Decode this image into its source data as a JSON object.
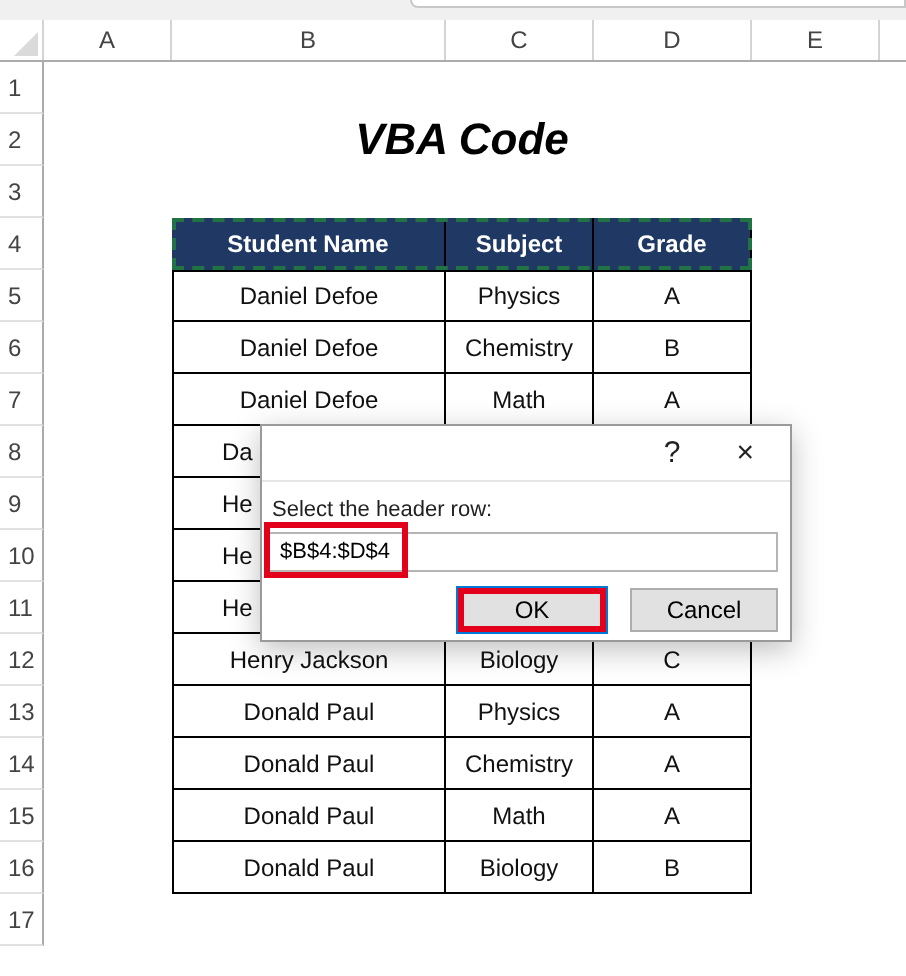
{
  "columns": [
    "A",
    "B",
    "C",
    "D",
    "E"
  ],
  "row_numbers": [
    "1",
    "2",
    "3",
    "4",
    "5",
    "6",
    "7",
    "8",
    "9",
    "10",
    "11",
    "12",
    "13",
    "14",
    "15",
    "16",
    "17"
  ],
  "title": "VBA Code",
  "table": {
    "columns": [
      "Student Name",
      "Subject",
      "Grade"
    ],
    "marquee": true,
    "rows": [
      {
        "cells": [
          "Daniel Defoe",
          "Physics",
          "A"
        ]
      },
      {
        "cells": [
          "Daniel Defoe",
          "Chemistry",
          "B"
        ]
      },
      {
        "cells": [
          "Daniel Defoe",
          "Math",
          "A"
        ]
      },
      {
        "cells": [
          "Da"
        ]
      },
      {
        "cells": [
          "He"
        ]
      },
      {
        "cells": [
          "He"
        ]
      },
      {
        "cells": [
          "He"
        ]
      },
      {
        "cells": [
          "Henry Jackson",
          "Biology",
          "C"
        ]
      },
      {
        "cells": [
          "Donald Paul",
          "Physics",
          "A"
        ]
      },
      {
        "cells": [
          "Donald Paul",
          "Chemistry",
          "A"
        ]
      },
      {
        "cells": [
          "Donald Paul",
          "Math",
          "A"
        ]
      },
      {
        "cells": [
          "Donald Paul",
          "Biology",
          "B"
        ]
      }
    ]
  },
  "dialog": {
    "help": "?",
    "close": "×",
    "prompt": "Select the header row:",
    "input": {
      "value": "$B$4:$D$4",
      "highlighted": true
    },
    "buttons": [
      {
        "label": "OK",
        "default": true,
        "highlighted": true
      },
      {
        "label": "Cancel",
        "default": false,
        "highlighted": false
      }
    ]
  }
}
